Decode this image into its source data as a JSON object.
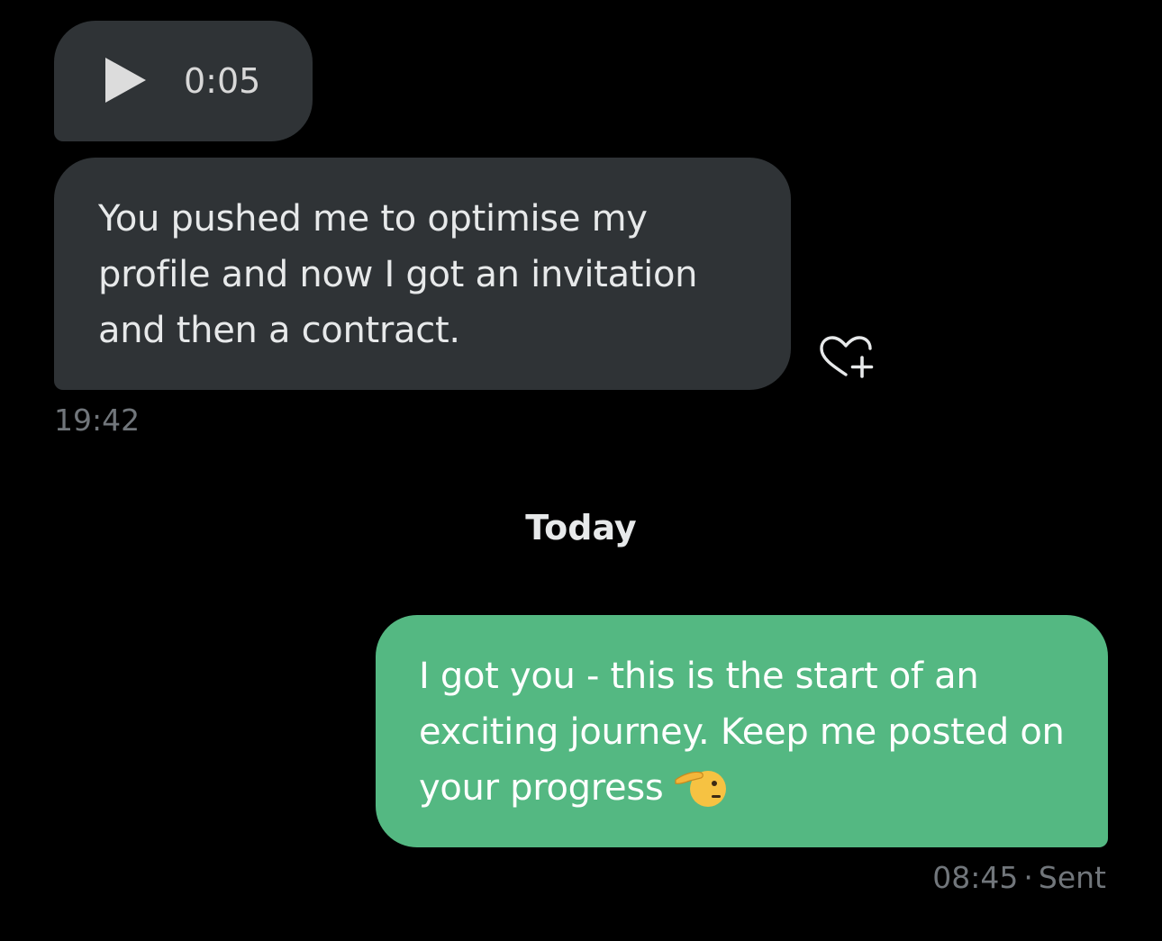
{
  "conversation": {
    "incoming": {
      "audio": {
        "duration": "0:05",
        "play_icon": "play-icon"
      },
      "message": {
        "text": "You pushed me to optimise my profile and now I got an invitation and then a contract.",
        "time": "19:42",
        "reaction_icon": "heart-plus-icon"
      }
    },
    "day_separator": "Today",
    "outgoing": {
      "message": {
        "text": "I got you - this is the start of an exciting journey. Keep me posted on your progress",
        "emoji_icon": "saluting-face-icon",
        "time": "08:45",
        "separator": "·",
        "status": "Sent"
      }
    }
  },
  "colors": {
    "background": "#000000",
    "incoming_bubble": "#2f3336",
    "outgoing_bubble": "#54b882",
    "muted_text": "#71767b"
  }
}
